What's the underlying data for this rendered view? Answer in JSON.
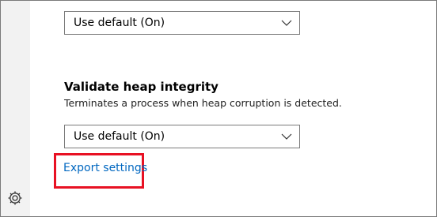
{
  "dropdowns": [
    {
      "value": "Use default (On)"
    },
    {
      "value": "Use default (On)"
    }
  ],
  "heap_section": {
    "title": "Validate heap integrity",
    "description": "Terminates a process when heap corruption is detected."
  },
  "export_link": {
    "label": "Export settings"
  },
  "colors": {
    "link": "#0067c0",
    "highlight": "#e81123",
    "rail": "#f2f2f2"
  },
  "icons": {
    "settings": "gear-icon",
    "dropdown": "chevron-down-icon"
  }
}
